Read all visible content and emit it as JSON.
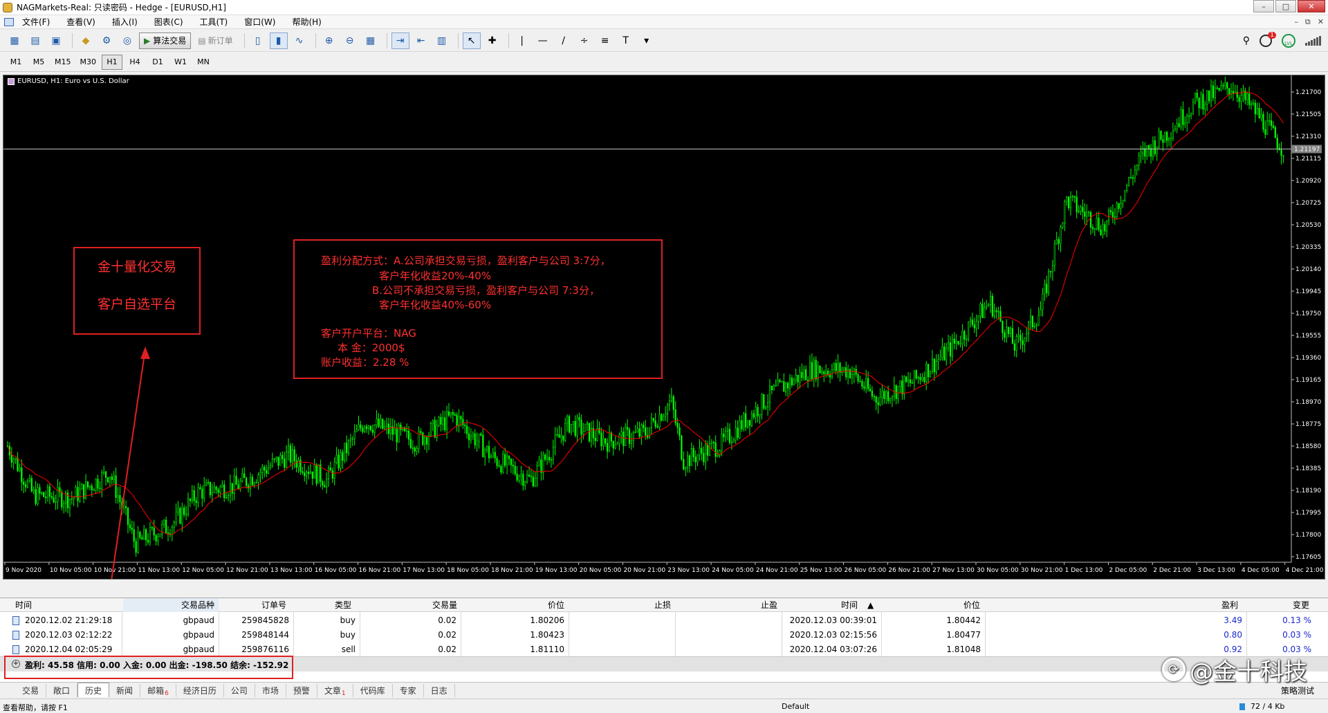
{
  "window": {
    "title": "NAGMarkets-Real: 只读密码 - Hedge - [EURUSD,H1]"
  },
  "menu": [
    "文件(F)",
    "查看(V)",
    "插入(I)",
    "图表(C)",
    "工具(T)",
    "窗口(W)",
    "帮助(H)"
  ],
  "toolbar": {
    "algo_label": "算法交易",
    "new_order_label": "新订单",
    "notifications_count": "1",
    "lvl_label": "LVL"
  },
  "timeframes": [
    "M1",
    "M5",
    "M15",
    "M30",
    "H1",
    "H4",
    "D1",
    "W1",
    "MN"
  ],
  "active_timeframe": "H1",
  "chart": {
    "title": "EURUSD, H1:  Euro vs U.S. Dollar",
    "current_price": "1.21197",
    "price_ticks": [
      "1.21700",
      "1.21505",
      "1.21310",
      "1.21115",
      "1.20920",
      "1.20725",
      "1.20530",
      "1.20335",
      "1.20140",
      "1.19945",
      "1.19750",
      "1.19555",
      "1.19360",
      "1.19165",
      "1.18970",
      "1.18775",
      "1.18580",
      "1.18385",
      "1.18190",
      "1.17995",
      "1.17800",
      "1.17605"
    ],
    "time_ticks": [
      "9 Nov 2020",
      "10 Nov 05:00",
      "10 Nov 21:00",
      "11 Nov 13:00",
      "12 Nov 05:00",
      "12 Nov 21:00",
      "13 Nov 13:00",
      "16 Nov 05:00",
      "16 Nov 21:00",
      "17 Nov 13:00",
      "18 Nov 05:00",
      "18 Nov 21:00",
      "19 Nov 13:00",
      "20 Nov 05:00",
      "20 Nov 21:00",
      "23 Nov 13:00",
      "24 Nov 05:00",
      "24 Nov 21:00",
      "25 Nov 13:00",
      "26 Nov 05:00",
      "26 Nov 21:00",
      "27 Nov 13:00",
      "30 Nov 05:00",
      "30 Nov 21:00",
      "1 Dec 13:00",
      "2 Dec 05:00",
      "2 Dec 21:00",
      "3 Dec 13:00",
      "4 Dec 05:00",
      "4 Dec 21:00"
    ],
    "colors": {
      "background": "#000000",
      "candles": "#00ff00",
      "moving_average": "#ff0000",
      "price_line": "#c0c0c0"
    }
  },
  "annotations": {
    "brand_line1": "金十量化交易",
    "brand_line2": "客户自选平台",
    "profit": {
      "line1": "盈利分配方式：A.公司承担交易亏损，盈利客户与公司 3:7分，",
      "line2": "客户年化收益20%-40%",
      "line3": "B.公司不承担交易亏损，盈利客户与公司 7:3分，",
      "line4": "客户年化收益40%-60%",
      "line5": "客户开户平台：NAG",
      "line6": "本  金：2000$",
      "line7": "账户收益：2.28 %"
    }
  },
  "history": {
    "columns": {
      "time": "时间",
      "symbol": "交易品种",
      "order": "订单号",
      "type": "类型",
      "volume": "交易量",
      "price": "价位",
      "sl": "止损",
      "tp": "止盈",
      "close_time": "时间",
      "close_price": "价位",
      "profit": "盈利",
      "change": "变更"
    },
    "rows": [
      {
        "time": "2020.12.02 21:29:18",
        "symbol": "gbpaud",
        "order": "259845828",
        "type": "buy",
        "volume": "0.02",
        "price": "1.80206",
        "sl": "",
        "tp": "",
        "close_time": "2020.12.03 00:39:01",
        "close_price": "1.80442",
        "profit": "3.49",
        "change": "0.13 %"
      },
      {
        "time": "2020.12.03 02:12:22",
        "symbol": "gbpaud",
        "order": "259848144",
        "type": "buy",
        "volume": "0.02",
        "price": "1.80423",
        "sl": "",
        "tp": "",
        "close_time": "2020.12.03 02:15:56",
        "close_price": "1.80477",
        "profit": "0.80",
        "change": "0.03 %"
      },
      {
        "time": "2020.12.04 02:05:29",
        "symbol": "gbpaud",
        "order": "259876116",
        "type": "sell",
        "volume": "0.02",
        "price": "1.81110",
        "sl": "",
        "tp": "",
        "close_time": "2020.12.04 03:07:26",
        "close_price": "1.81048",
        "profit": "0.92",
        "change": "0.03 %"
      }
    ],
    "summary": "盈利: 45.58  信用: 0.00  入金: 0.00  出金: -198.50  结余: -152.92"
  },
  "tabs": [
    {
      "label": "交易"
    },
    {
      "label": "敞口"
    },
    {
      "label": "历史"
    },
    {
      "label": "新闻"
    },
    {
      "label": "邮箱",
      "badge": "6"
    },
    {
      "label": "经济日历"
    },
    {
      "label": "公司"
    },
    {
      "label": "市场"
    },
    {
      "label": "预警"
    },
    {
      "label": "文章",
      "badge": "1"
    },
    {
      "label": "代码库"
    },
    {
      "label": "专家"
    },
    {
      "label": "日志"
    }
  ],
  "active_tab": "历史",
  "strategy_label": "策略测试",
  "status": {
    "left": "查看帮助，请按 F1",
    "profile": "Default",
    "traffic": "72 / 4 Kb"
  },
  "watermark": "@金十科技"
}
